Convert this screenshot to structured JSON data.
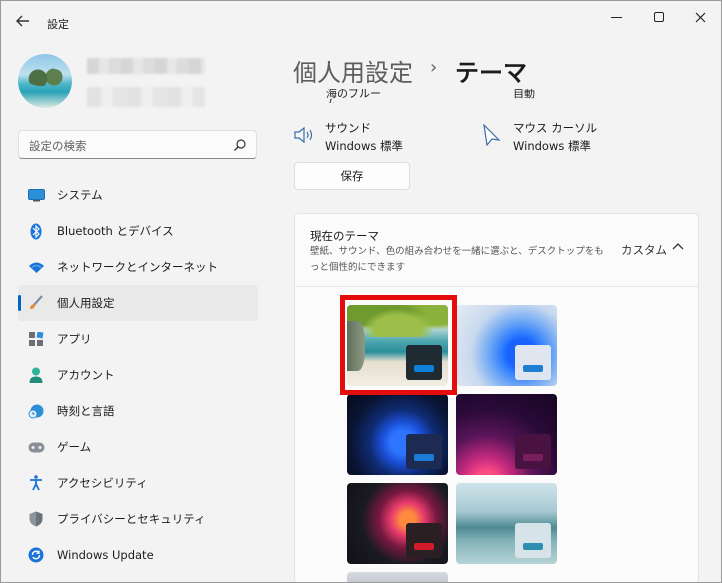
{
  "window": {
    "title": "設定"
  },
  "sidebar": {
    "search_placeholder": "設定の検索",
    "items": [
      {
        "label": "システム",
        "icon": "display-icon"
      },
      {
        "label": "Bluetooth とデバイス",
        "icon": "bluetooth-icon"
      },
      {
        "label": "ネットワークとインターネット",
        "icon": "wifi-icon"
      },
      {
        "label": "個人用設定",
        "icon": "brush-icon",
        "active": true
      },
      {
        "label": "アプリ",
        "icon": "apps-icon"
      },
      {
        "label": "アカウント",
        "icon": "person-icon"
      },
      {
        "label": "時刻と言語",
        "icon": "clock-globe-icon"
      },
      {
        "label": "ゲーム",
        "icon": "gamepad-icon"
      },
      {
        "label": "アクセシビリティ",
        "icon": "accessibility-icon"
      },
      {
        "label": "プライバシーとセキュリティ",
        "icon": "shield-icon"
      },
      {
        "label": "Windows Update",
        "icon": "update-icon"
      }
    ]
  },
  "main": {
    "breadcrumb_parent": "個人用設定",
    "breadcrumb_separator": "›",
    "breadcrumb_current": "テーマ",
    "cut_off_left": "海のブルーム",
    "cut_off_right": "自動",
    "sound": {
      "label": "サウンド",
      "value": "Windows 標準"
    },
    "cursor": {
      "label": "マウス カーソル",
      "value": "Windows 標準"
    },
    "save_label": "保存",
    "current_theme": {
      "title": "現在のテーマ",
      "description": "壁紙、サウンド、色の組み合わせを一緒に選ぶと、デスクトップをもっと個性的にできます",
      "value": "カスタム"
    },
    "themes": [
      {
        "name": "custom-beach",
        "swatch": "#1f2b32",
        "accent": "#0f7fd8",
        "selected": true
      },
      {
        "name": "windows-light",
        "swatch": "#dfe6ef",
        "accent": "#1e7fd0"
      },
      {
        "name": "windows-dark",
        "swatch": "#1d2a52",
        "accent": "#1b7cd8"
      },
      {
        "name": "glow",
        "swatch": "#4a1240",
        "accent": "#7a1f5e"
      },
      {
        "name": "captured-motion",
        "swatch": "#2a1f22",
        "accent": "#d11a2a"
      },
      {
        "name": "flow",
        "swatch": "#d6e3e8",
        "accent": "#2f8fb0"
      }
    ]
  },
  "colors": {
    "selection": "#e50c0c",
    "accent": "#0067c0"
  }
}
